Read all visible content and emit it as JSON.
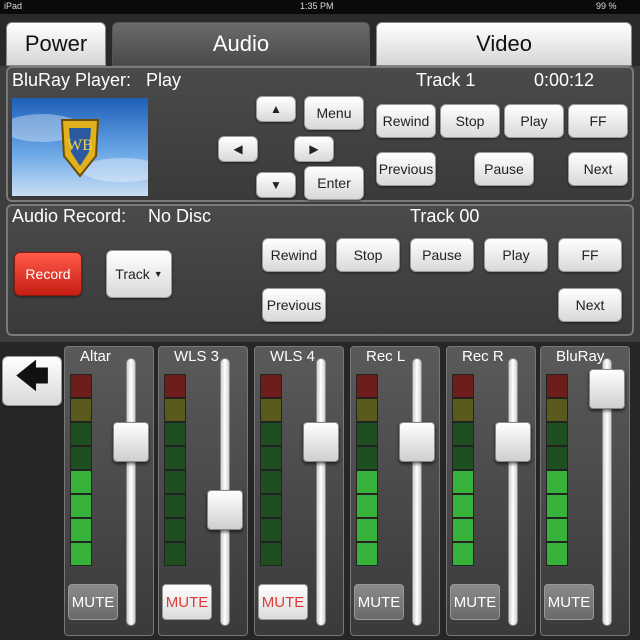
{
  "status": {
    "carrier": "iPad",
    "time": "1:35 PM",
    "battery": "99 %"
  },
  "tabs": [
    {
      "label": "Power",
      "active": false
    },
    {
      "label": "Audio",
      "active": true
    },
    {
      "label": "Video",
      "active": false
    }
  ],
  "bluray": {
    "title": "BluRay Player:",
    "state": "Play",
    "track": "Track 1",
    "time": "0:00:12",
    "thumbnail_icon": "studio-logo-icon",
    "nav": {
      "menu": "Menu",
      "enter": "Enter"
    },
    "transport": [
      "Rewind",
      "Stop",
      "Play",
      "FF"
    ],
    "secondary": {
      "previous": "Previous",
      "pause": "Pause",
      "next": "Next"
    }
  },
  "recorder": {
    "title": "Audio Record:",
    "state": "No Disc",
    "track": "Track 00",
    "record_label": "Record",
    "track_dropdown": "Track",
    "transport": [
      "Rewind",
      "Stop",
      "Pause",
      "Play",
      "FF"
    ],
    "previous": "Previous",
    "next": "Next"
  },
  "back_icon": "back-arrow-icon",
  "channels": [
    {
      "name": "Altar",
      "level": 4,
      "fader": 0.28,
      "mute": "MUTE",
      "muted": false
    },
    {
      "name": "WLS 3",
      "level": 0,
      "fader": 0.58,
      "mute": "MUTE",
      "muted": true
    },
    {
      "name": "WLS 4",
      "level": 0,
      "fader": 0.28,
      "mute": "MUTE",
      "muted": true
    },
    {
      "name": "Rec L",
      "level": 4,
      "fader": 0.28,
      "mute": "MUTE",
      "muted": false
    },
    {
      "name": "Rec R",
      "level": 4,
      "fader": 0.28,
      "mute": "MUTE",
      "muted": false
    },
    {
      "name": "BluRay",
      "level": 4,
      "fader": 0.05,
      "mute": "MUTE",
      "muted": false
    }
  ],
  "colors": {
    "meter_green": "#37b23a",
    "meter_dark_green": "#1f4f20",
    "meter_olive": "#5a5a1c",
    "meter_red": "#6e1e1a",
    "record_red": "#d8291c"
  }
}
